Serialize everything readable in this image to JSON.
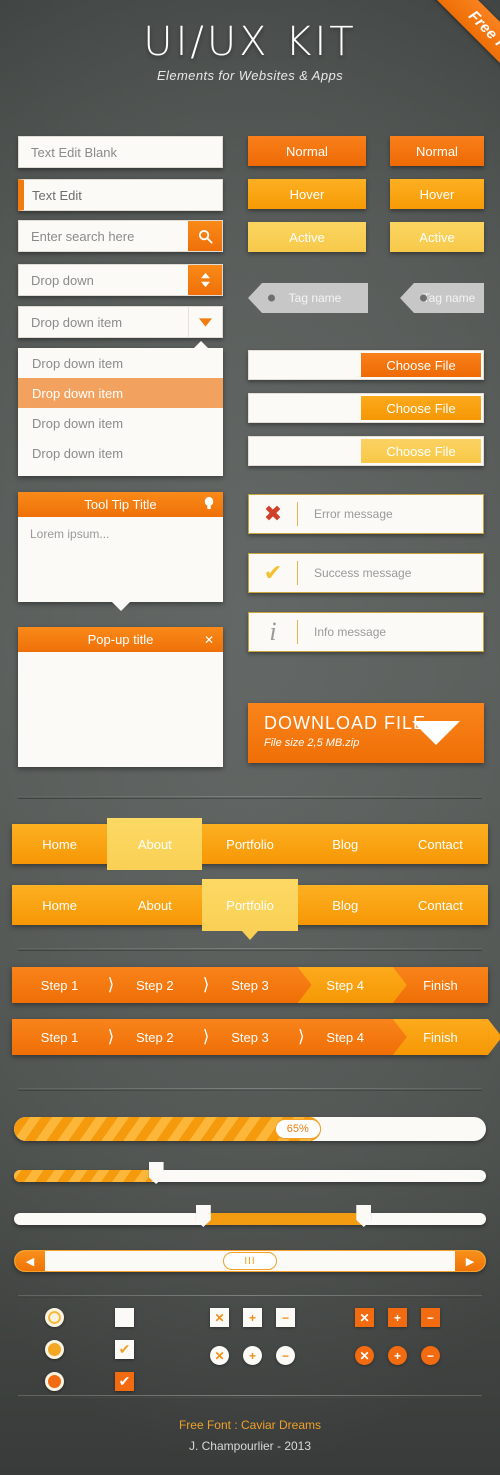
{
  "ribbon": {
    "label": "Free PSD"
  },
  "header": {
    "title": "UI/UX KIT",
    "subtitle": "Elements for Websites & Apps"
  },
  "forms": {
    "text_blank": "Text Edit Blank",
    "text_focus": "Text Edit",
    "search_placeholder": "Enter search here",
    "search_icon": "search-icon",
    "dropdown": "Drop down",
    "dropdown_spinner_icon": "updown-arrows-icon",
    "dropdown_item": "Drop down item",
    "dropdown_caret_icon": "chevron-down-icon",
    "list_items": [
      {
        "label": "Drop down item",
        "selected": false
      },
      {
        "label": "Drop down item",
        "selected": true
      },
      {
        "label": "Drop down item",
        "selected": false
      },
      {
        "label": "Drop down item",
        "selected": false
      }
    ]
  },
  "tooltip": {
    "title": "Tool Tip Title",
    "icon": "lightbulb-icon",
    "body": "Lorem ipsum..."
  },
  "popup": {
    "title": "Pop-up title",
    "close_icon": "close-icon"
  },
  "buttons": {
    "left": [
      {
        "label": "Normal",
        "state": "normal"
      },
      {
        "label": "Hover",
        "state": "hover"
      },
      {
        "label": "Active",
        "state": "active"
      }
    ],
    "right": [
      {
        "label": "Normal",
        "state": "normal"
      },
      {
        "label": "Hover",
        "state": "hover"
      },
      {
        "label": "Active",
        "state": "active"
      }
    ]
  },
  "tags": [
    {
      "label": "Tag name"
    },
    {
      "label": "Tag name"
    }
  ],
  "file_inputs": [
    {
      "button": "Choose File",
      "variant": "c1"
    },
    {
      "button": "Choose File",
      "variant": "c2"
    },
    {
      "button": "Choose File",
      "variant": "c3"
    }
  ],
  "messages": [
    {
      "text": "Error message",
      "icon": "cross-icon",
      "color": "#d0402a"
    },
    {
      "text": "Success message",
      "icon": "check-icon",
      "color": "#f3c02e"
    },
    {
      "text": "Info message",
      "icon": "info-icon",
      "color": "#9a9a9a"
    }
  ],
  "download": {
    "title": "DOWNLOAD FILE",
    "subtitle": "File size 2,5 MB.zip",
    "icon": "download-arrow-icon"
  },
  "nav_primary": [
    {
      "label": "Home",
      "active": false
    },
    {
      "label": "About",
      "active": true
    },
    {
      "label": "Portfolio",
      "active": false
    },
    {
      "label": "Blog",
      "active": false
    },
    {
      "label": "Contact",
      "active": false
    }
  ],
  "nav_secondary": [
    {
      "label": "Home",
      "active": false
    },
    {
      "label": "About",
      "active": false
    },
    {
      "label": "Portfolio",
      "active": true
    },
    {
      "label": "Blog",
      "active": false
    },
    {
      "label": "Contact",
      "active": false
    }
  ],
  "steps_primary": [
    {
      "label": "Step 1",
      "highlight": false
    },
    {
      "label": "Step 2",
      "highlight": false
    },
    {
      "label": "Step 3",
      "highlight": false
    },
    {
      "label": "Step 4",
      "highlight": true
    },
    {
      "label": "Finish",
      "highlight": false
    }
  ],
  "steps_secondary": [
    {
      "label": "Step 1",
      "highlight": false
    },
    {
      "label": "Step 2",
      "highlight": false
    },
    {
      "label": "Step 3",
      "highlight": false
    },
    {
      "label": "Step 4",
      "highlight": false
    },
    {
      "label": "Finish",
      "highlight": true
    }
  ],
  "progress": {
    "value": 65,
    "label": "65%"
  },
  "slider_single": {
    "value": 30
  },
  "slider_range": {
    "from": 40,
    "to": 74
  },
  "scrollbar": {
    "left_icon": "arrow-left-icon",
    "right_icon": "arrow-right-icon",
    "grip_icon": "grip-lines-icon",
    "grip_label": "III"
  },
  "controls": {
    "radios": [
      {
        "name": "radio-empty",
        "cls": "r1"
      },
      {
        "name": "radio-hover",
        "cls": "r2"
      },
      {
        "name": "radio-selected",
        "cls": "r3"
      }
    ],
    "checkboxes": [
      {
        "name": "checkbox-empty",
        "glyph": "",
        "cls": ""
      },
      {
        "name": "checkbox-checked",
        "glyph": "✔",
        "cls": "ck"
      },
      {
        "name": "checkbox-checked-filled",
        "glyph": "✔",
        "cls": "fill"
      }
    ],
    "squares_light": [
      {
        "name": "close-square-icon",
        "glyph": "✕"
      },
      {
        "name": "plus-square-icon",
        "glyph": "+"
      },
      {
        "name": "minus-square-icon",
        "glyph": "−"
      }
    ],
    "circles_light": [
      {
        "name": "close-circle-icon",
        "glyph": "✕"
      },
      {
        "name": "plus-circle-icon",
        "glyph": "+"
      },
      {
        "name": "minus-circle-icon",
        "glyph": "−"
      }
    ],
    "squares_dark": [
      {
        "name": "close-square-icon",
        "glyph": "✕"
      },
      {
        "name": "plus-square-icon",
        "glyph": "+"
      },
      {
        "name": "minus-square-icon",
        "glyph": "−"
      }
    ],
    "circles_dark": [
      {
        "name": "close-circle-icon",
        "glyph": "✕"
      },
      {
        "name": "plus-circle-icon",
        "glyph": "+"
      },
      {
        "name": "minus-circle-icon",
        "glyph": "−"
      }
    ]
  },
  "footer": {
    "line1": "Free Font : Caviar Dreams",
    "line2": "J. Champourlier - 2013"
  }
}
